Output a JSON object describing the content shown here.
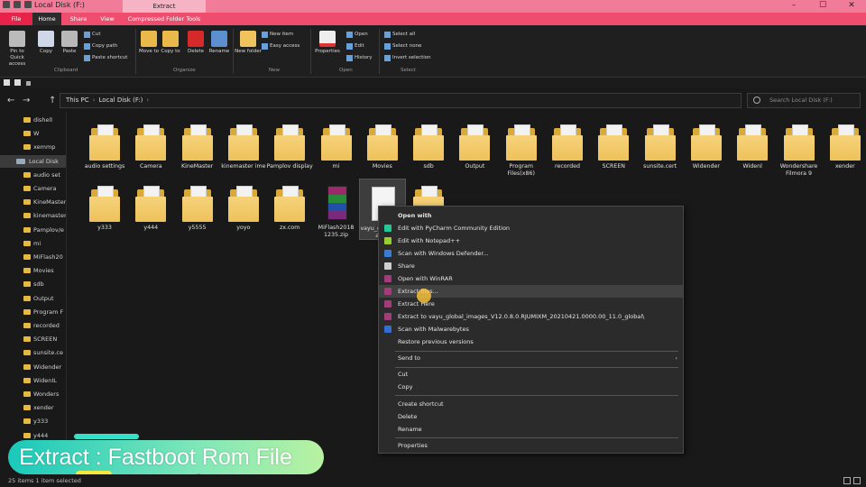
{
  "window": {
    "title": "Local Disk (F:)",
    "context_tab": "Extract",
    "controls": [
      "–",
      "☐",
      "✕"
    ]
  },
  "ribbon_tabs": [
    "File",
    "Home",
    "Share",
    "View",
    "Compressed Folder Tools"
  ],
  "ribbon": {
    "pin": "Pin to Quick access",
    "copy": "Copy",
    "paste": "Paste",
    "cut": "Cut",
    "copy_path": "Copy path",
    "paste_shortcut": "Paste shortcut",
    "move_to": "Move to",
    "copy_to": "Copy to",
    "delete": "Delete",
    "rename": "Rename",
    "new_folder": "New folder",
    "new_item": "New item",
    "easy_access": "Easy access",
    "properties": "Properties",
    "open": "Open",
    "edit": "Edit",
    "history": "History",
    "select_all": "Select all",
    "select_none": "Select none",
    "invert_selection": "Invert selection",
    "groups": [
      "Clipboard",
      "Organize",
      "New",
      "Open",
      "Select"
    ]
  },
  "nav": {
    "back": "←",
    "forward": "→",
    "up": "↑",
    "path": [
      "This PC",
      "Local Disk (F:)"
    ],
    "refresh": "↻",
    "search_placeholder": "Search Local Disk (F:)"
  },
  "sidebar": [
    "dishell",
    "W",
    "xemmp",
    "Local Disk",
    "audio set",
    "Camera",
    "KineMaster",
    "kinemaster",
    "Pamplov/e",
    "mi",
    "MiFlash20",
    "Movies",
    "sdb",
    "Output",
    "Program F",
    "recorded",
    "SCREEN",
    "sunsite.ce",
    "Widender",
    "WidenIL",
    "Wonders",
    "xender",
    "y333",
    "y444"
  ],
  "files": {
    "row1": [
      "audio settings",
      "Camera",
      "KineMaster",
      "kinemaster ime",
      "Pamplov display",
      "mi",
      "Movies",
      "sdb",
      "Output",
      "Program Files(x86)",
      "recorded",
      "SCREEN",
      "sunsite.cert",
      "Widender",
      "Widenl",
      "Wondershare Filmora 9",
      "xender"
    ],
    "row2": [
      "y333",
      "y444",
      "y5555",
      "yoyo",
      "zx.com",
      "MiFlash2018 1235.zip",
      "vayu_global_images",
      "zip"
    ]
  },
  "context_menu": {
    "open_with": "Open with",
    "items": [
      "Edit with PyCharm Community Edition",
      "Edit with Notepad++",
      "Scan with Windows Defender...",
      "Share",
      "Open with WinRAR",
      "Extract files...",
      "Extract Here",
      "Extract to vayu_global_images_V12.0.8.0.RJUMIXM_20210421.0000.00_11.0_global\\",
      "Scan with Malwarebytes",
      "Restore previous versions",
      "Send to",
      "Cut",
      "Copy",
      "Create shortcut",
      "Delete",
      "Rename",
      "Properties"
    ]
  },
  "caption": "Extract : Fastboot Rom File",
  "status": "25 items   1 item selected",
  "colors": {
    "title_bar": "#f07c99",
    "tab_bar": "#ef4d6e",
    "folder": "#eec25b",
    "menu_bg": "#2b2b2b",
    "caption_start": "#19c9ba",
    "caption_end": "#b8f2a1"
  }
}
